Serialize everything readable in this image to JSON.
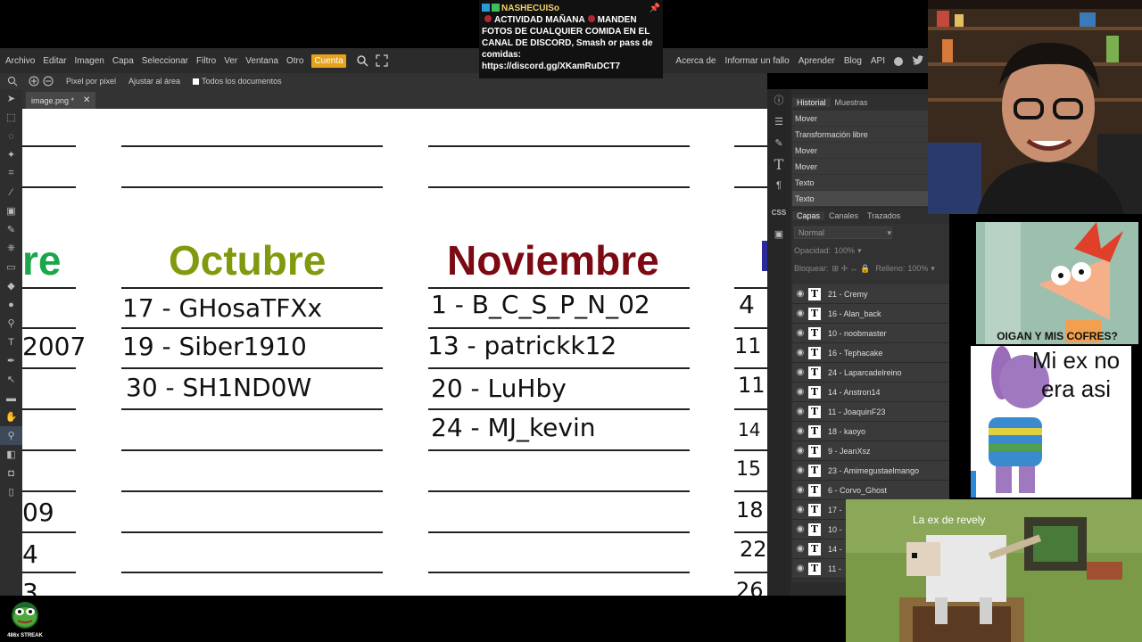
{
  "chat": {
    "username": "NASHECUISo",
    "message_1": "ACTIVIDAD MAÑANA",
    "message_2": "MANDEN FOTOS DE CUALQUIER COMIDA EN EL CANAL DE DISCORD, Smash or pass de comidas:",
    "link": "https://discord.gg/XKamRuDCT7"
  },
  "menubar": {
    "items": [
      "Archivo",
      "Editar",
      "Imagen",
      "Capa",
      "Seleccionar",
      "Filtro",
      "Ver",
      "Ventana",
      "Otro"
    ],
    "active": "Cuenta",
    "right_items": [
      "Acerca de",
      "Informar un fallo",
      "Aprender",
      "Blog",
      "API"
    ]
  },
  "options": {
    "pixel": "Pixel por pixel",
    "fit": "Ajustar al área",
    "all_docs": "Todos los documentos"
  },
  "document": {
    "tab_name": "image.png *"
  },
  "canvas": {
    "partial_title": "re",
    "partial_left_values": [
      "2007",
      "09",
      "4",
      "3"
    ],
    "months": [
      {
        "title": "Octubre",
        "color": "#7f9a0d",
        "entries": [
          "17 - GHosaTFXx",
          "19 - Siber1910",
          "30 - SH1ND0W"
        ]
      },
      {
        "title": "Noviembre",
        "color": "#7b0a12",
        "entries": [
          "1 - B_C_S_P_N_02",
          "13 - patrickk12",
          "20 - LuHby",
          "24 - MJ_kevin"
        ]
      }
    ],
    "partial_right_values": [
      "4",
      "11",
      "11",
      "14",
      "15",
      "18",
      "22",
      "26"
    ],
    "accent_green": "#1aa64a"
  },
  "history": {
    "tabs": [
      "Historial",
      "Muestras"
    ],
    "items": [
      "Mover",
      "Transformación libre",
      "Mover",
      "Mover",
      "Texto",
      "Texto"
    ]
  },
  "layers": {
    "tabs": [
      "Capas",
      "Canales",
      "Trazados"
    ],
    "blend_mode": "Normal",
    "opacity_label": "Opacidad:",
    "opacity_value": "100%",
    "lock_label": "Bloquear:",
    "fill_label": "Relleno:",
    "fill_value": "100%",
    "items": [
      "21 - Cremy",
      "16 - Alan_back",
      "10 - noobmaster",
      "16 - Tephacake",
      "24 - Laparcadelreino",
      "14 - Anstron14",
      "11 - JoaquinF23",
      "18 - kaoyo",
      "9 - JeanXsz",
      "23 - Amimegustaelmango",
      "6 - Corvo_Ghost",
      "17 -",
      "10 -",
      "14 -",
      "11 -"
    ]
  },
  "memes": {
    "meme1_caption": "OIGAN Y MIS COFRES?",
    "meme2_caption": "Mi ex no era asi",
    "meme3_caption": "La ex de revely"
  },
  "streak": {
    "label": "486x STREAK"
  }
}
